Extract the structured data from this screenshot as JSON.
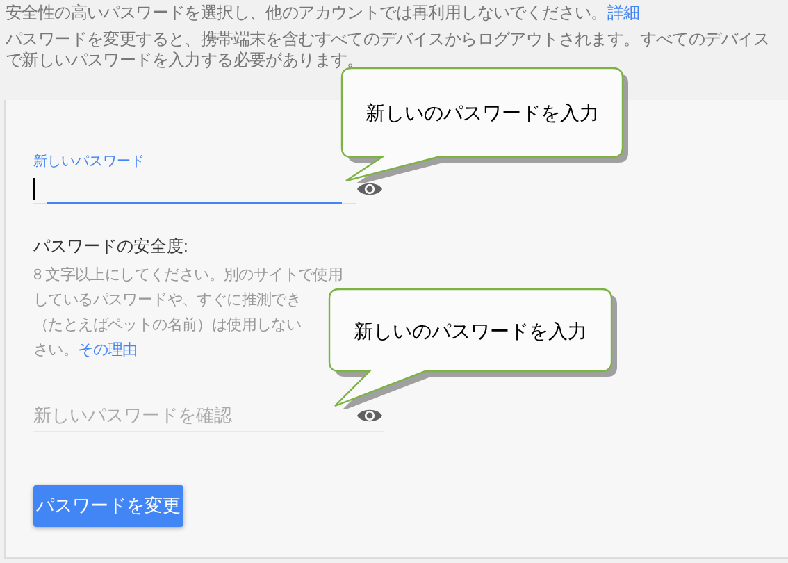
{
  "intro": {
    "text": "安全性の高いパスワードを選択し、他のアカウントでは再利用しないでください。",
    "link": "詳細"
  },
  "notice": "パスワードを変更すると、携帯端末を含むすべてのデバイスからログアウトされます。すべてのデバイスで新しいパスワードを入力する必要があります。",
  "fields": [
    {
      "label": "新しいパスワード",
      "focused": true
    },
    {
      "placeholder": "新しいパスワードを確認",
      "focused": false
    }
  ],
  "strength": {
    "title": "パスワードの安全度:",
    "hint_lines": [
      "8 文字以上にしてください。別のサイトで使用",
      "しているパスワードや、すぐに推測でき",
      "（たとえばペットの名前）は使用しない",
      "さい。"
    ],
    "hint_link": "その理由"
  },
  "button": "パスワードを変更",
  "callouts": [
    {
      "text": "新しいのパスワードを入力"
    },
    {
      "text": "新しいのパスワードを入力"
    }
  ]
}
